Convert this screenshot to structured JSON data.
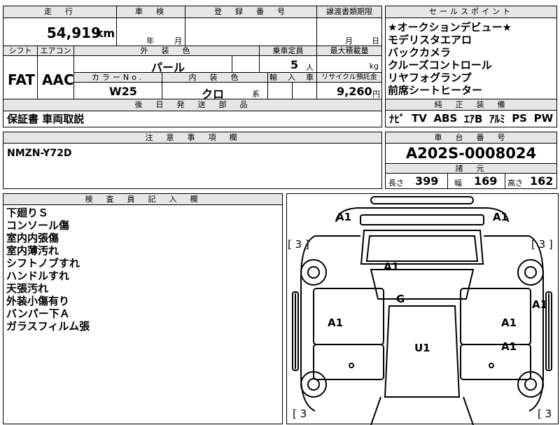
{
  "header": {
    "mileage_label": "走　行",
    "shaken_label": "車　検",
    "registration_label": "登　録　番　号",
    "transfer_label": "譲渡書類期限",
    "selling_points_label": "セールスポイント"
  },
  "values": {
    "mileage": "54,919",
    "mileage_unit": "km",
    "shaken_year": "年",
    "shaken_month": "月",
    "transfer_month": "月",
    "transfer_day": "日"
  },
  "row2": {
    "shift_label": "シフト",
    "aircon_label": "エアコン",
    "color_label": "外　装　色",
    "capacity_label": "乗車定員",
    "max_load_label": "最大積載量",
    "shift": "FAT",
    "aircon": "AAC",
    "color": "パール",
    "capacity": "5",
    "capacity_unit": "人",
    "load_unit": "kg",
    "color_no_label": "カラーNo.",
    "interior_label": "内　装　色",
    "import_label": "輸　入　車",
    "recycle_label": "リサイクル預託金",
    "color_no": "W25",
    "interior": "クロ",
    "interior_suffix": "系",
    "recycle": "9,260",
    "recycle_unit": "円"
  },
  "selling_points": [
    "★オークションデビュー★",
    "モデリスタエアロ",
    "バックカメラ",
    "クルーズコントロール",
    "リヤフォグランプ",
    "前席シートヒーター"
  ],
  "parts": {
    "label": "後　日　発　送　部　品",
    "value": "保証書 車両取説"
  },
  "equipment": {
    "label": "純　正　装　備",
    "items": [
      "ﾅﾋﾞ",
      "TV",
      "ABS",
      "ｴｱB",
      "ｱﾙﾐ",
      "PS",
      "PW"
    ]
  },
  "notes": {
    "label": "注　意　事　項　欄",
    "value": "NMZN-Y72D"
  },
  "chassis": {
    "label": "車　台　番　号",
    "value": "A202S-0008024",
    "spec_label": "諸　元",
    "length_label": "長さ",
    "length": "399",
    "width_label": "幅",
    "width": "169",
    "height_label": "高さ",
    "height": "162"
  },
  "inspector": {
    "label": "検　査　員　記　入　欄",
    "items": [
      "下廻りＳ",
      "コンソール傷",
      "室内内張傷",
      "室内薄汚れ",
      "シフトノブすれ",
      "ハンドルすれ",
      "天張汚れ",
      "外装小傷有り",
      "バンパー下Ａ",
      "ガラスフィルム張"
    ]
  },
  "diagram": {
    "tl": "A1",
    "tr": "A1",
    "hood": "A1",
    "roof_front": "G",
    "left_front": "A1",
    "right_front": "A1",
    "right_side": "A1",
    "roof": "U1",
    "right_rear": "A1",
    "tire_tl": "[ 3 ]",
    "tire_tr": "[ 3 ]",
    "tire_bl": "[ 3",
    "tire_br": "[ 3"
  }
}
